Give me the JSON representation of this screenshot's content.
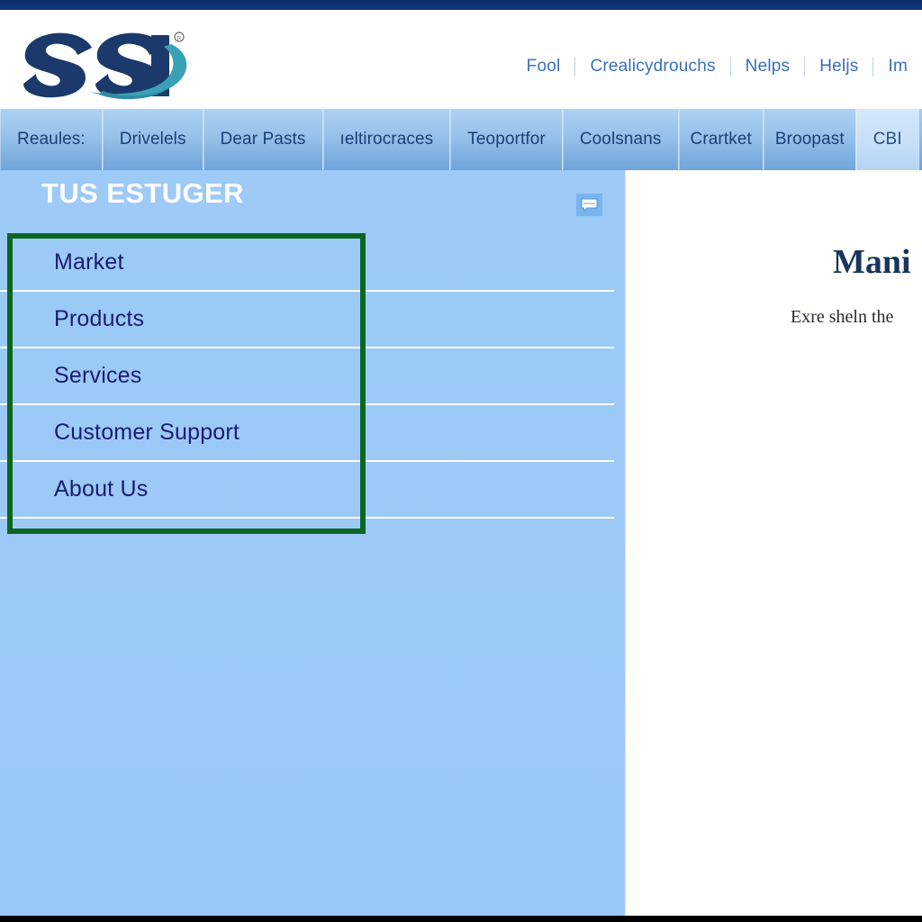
{
  "colors": {
    "top_strip": "#0d2f6e",
    "nav_tab_bg": "#93bfe9",
    "nav_tab_active_bg": "#c4dff8",
    "sidebar_bg": "#9dcaf7",
    "menu_text": "#1b1b72",
    "highlight_border": "#0b6623",
    "header_link": "#3a6fb5",
    "logo_navy": "#1b3a6b",
    "logo_teal": "#3aa0b5",
    "content_title": "#17355e",
    "bottom_bar": "#000000"
  },
  "logo": {
    "text": "SSI",
    "trademark": "®",
    "alt": "ssi-logo"
  },
  "header": {
    "links": [
      {
        "label": "Fool"
      },
      {
        "label": "Crealicydrouchs"
      },
      {
        "label": "Nelps"
      },
      {
        "label": "Heljs"
      },
      {
        "label": "Im"
      }
    ]
  },
  "nav": {
    "tabs": [
      {
        "label": "Reaules:",
        "active": false
      },
      {
        "label": "Drivelels",
        "active": false
      },
      {
        "label": "Dear Pasts",
        "active": false
      },
      {
        "label": "ıeltirocraces",
        "active": false
      },
      {
        "label": "Teoportfor",
        "active": false
      },
      {
        "label": "Coolsnans",
        "active": false
      },
      {
        "label": "Crartket",
        "active": false
      },
      {
        "label": "Broopast",
        "active": false
      },
      {
        "label": "CBI",
        "active": true
      }
    ]
  },
  "sidebar": {
    "title": "TUS ESTUGER",
    "chat_icon": "chat-bubble-icon",
    "menu": [
      {
        "label": "Market"
      },
      {
        "label": "Products"
      },
      {
        "label": "Services"
      },
      {
        "label": "Customer Support"
      },
      {
        "label": "About Us"
      }
    ]
  },
  "content": {
    "title": "Mani",
    "subtitle": "Exre sheln the "
  }
}
